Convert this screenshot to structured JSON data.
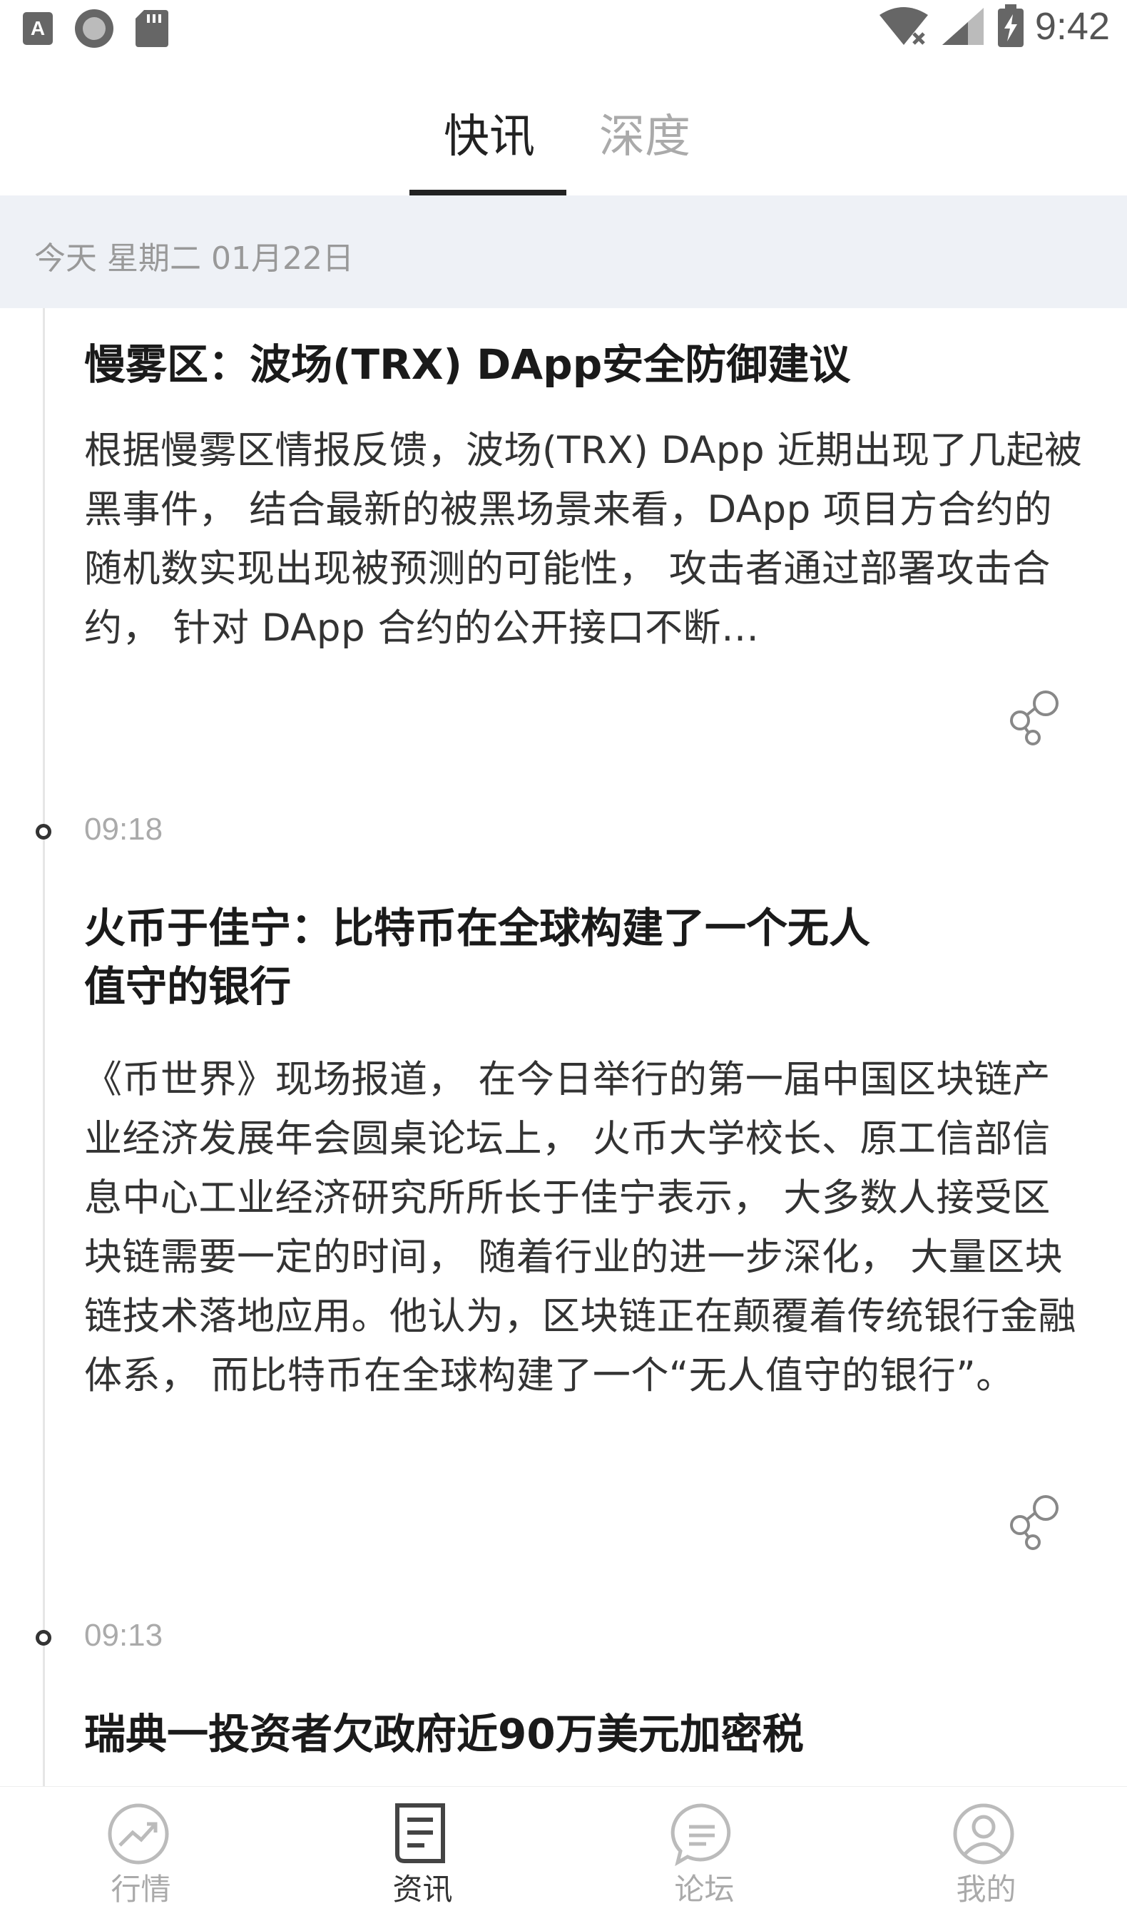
{
  "status_bar": {
    "time": "9:42",
    "left_icons": [
      "a-app-icon",
      "circle-app-icon",
      "sd-card-icon"
    ],
    "right_icons": [
      "wifi-off-icon",
      "cell-signal-icon",
      "battery-charging-icon"
    ]
  },
  "tabs": [
    {
      "label": "快讯",
      "active": true
    },
    {
      "label": "深度",
      "active": false
    }
  ],
  "date_bar": {
    "text": "今天 星期二 01月22日"
  },
  "feed": [
    {
      "time": "",
      "title": "慢雾区：波场(TRX) DApp安全防御建议",
      "body": "根据慢雾区情报反馈，波场(TRX) DApp 近期出现了几起被黑事件， 结合最新的被黑场景来看，DApp 项目方合约的随机数实现出现被预测的可能性， 攻击者通过部署攻击合约， 针对 DApp 合约的公开接口不断…"
    },
    {
      "time": "09:18",
      "title": "火币于佳宁：比特币在全球构建了一个无人值守的银行",
      "body": "《币世界》现场报道， 在今日举行的第一届中国区块链产业经济发展年会圆桌论坛上， 火币大学校长、原工信部信息中心工业经济研究所所长于佳宁表示， 大多数人接受区块链需要一定的时间， 随着行业的进一步深化， 大量区块链技术落地应用。他认为，区块链正在颠覆着传统银行金融体系， 而比特币在全球构建了一个“无人值守的银行”。"
    },
    {
      "time": "09:13",
      "title": "瑞典一投资者欠政府近90万美元加密税",
      "body": ""
    }
  ],
  "bottom_nav": [
    {
      "label": "行情",
      "icon": "trend-chart-icon",
      "active": false
    },
    {
      "label": "资讯",
      "icon": "document-icon",
      "active": true
    },
    {
      "label": "论坛",
      "icon": "chat-bubble-icon",
      "active": false
    },
    {
      "label": "我的",
      "icon": "user-profile-icon",
      "active": false
    }
  ]
}
